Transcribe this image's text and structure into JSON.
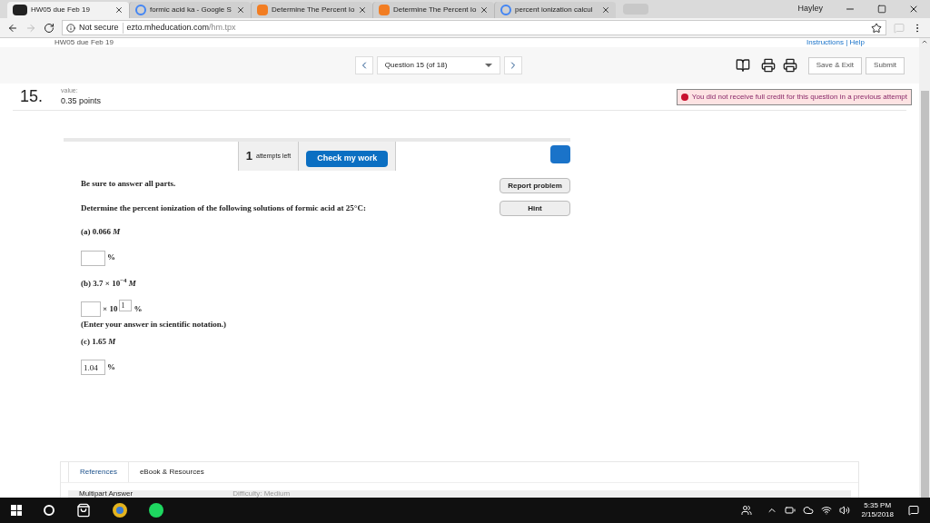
{
  "browser": {
    "tabs": [
      {
        "label": "HW05 due Feb 19",
        "kind": "mh",
        "selected": true
      },
      {
        "label": "formic acid ka - Google S",
        "kind": "google",
        "selected": false
      },
      {
        "label": "Determine The Percent Io",
        "kind": "chegg",
        "selected": false
      },
      {
        "label": "Determine The Percent Io",
        "kind": "chegg",
        "selected": false
      },
      {
        "label": "percent ionization calcul",
        "kind": "google",
        "selected": false
      }
    ],
    "user": "Hayley",
    "security": "Not secure",
    "url_host": "ezto.mheducation.com",
    "url_path": "/hm.tpx"
  },
  "page_header": {
    "assignment": "HW05 due Feb 19",
    "links": "Instructions | Help"
  },
  "nav": {
    "question": "Question 15 (of 18)",
    "buttons": [
      "Save & Exit",
      "Submit"
    ]
  },
  "question": {
    "number": "15.",
    "value_label": "value:",
    "points": "0.35 points",
    "alert": "You did not receive full credit for this question in a previous attempt",
    "attempts_count": "1",
    "attempts_label": "attempts left",
    "check_button": "Check my work",
    "side_buttons": [
      "Report problem",
      "Hint"
    ],
    "instructions": "Be sure to answer all parts.",
    "prompt": "Determine the percent ionization of the following solutions of formic acid at 25°C:",
    "parts": [
      {
        "kind": "simple",
        "label": "(a) 0.066 *M*",
        "unit": "%"
      },
      {
        "kind": "scientific",
        "label": "(b) 3.7 × 10$^{−4}$ *M*",
        "times": "× 10",
        "exponent": "1",
        "unit": "%",
        "note": "(Enter your answer in scientific notation.)"
      },
      {
        "kind": "simple",
        "label": "(c) 1.65 *M*",
        "value": "1.04",
        "unit": "%"
      }
    ]
  },
  "bottom_tabs": [
    {
      "label": "References",
      "selected": true
    },
    {
      "label": "eBook & Resources",
      "selected": false
    }
  ],
  "summary": {
    "title": "Multipart Answer",
    "difficulty": "Difficulty: Medium"
  },
  "taskbar": {
    "time": "5:35 PM",
    "date": "2/15/2018"
  }
}
